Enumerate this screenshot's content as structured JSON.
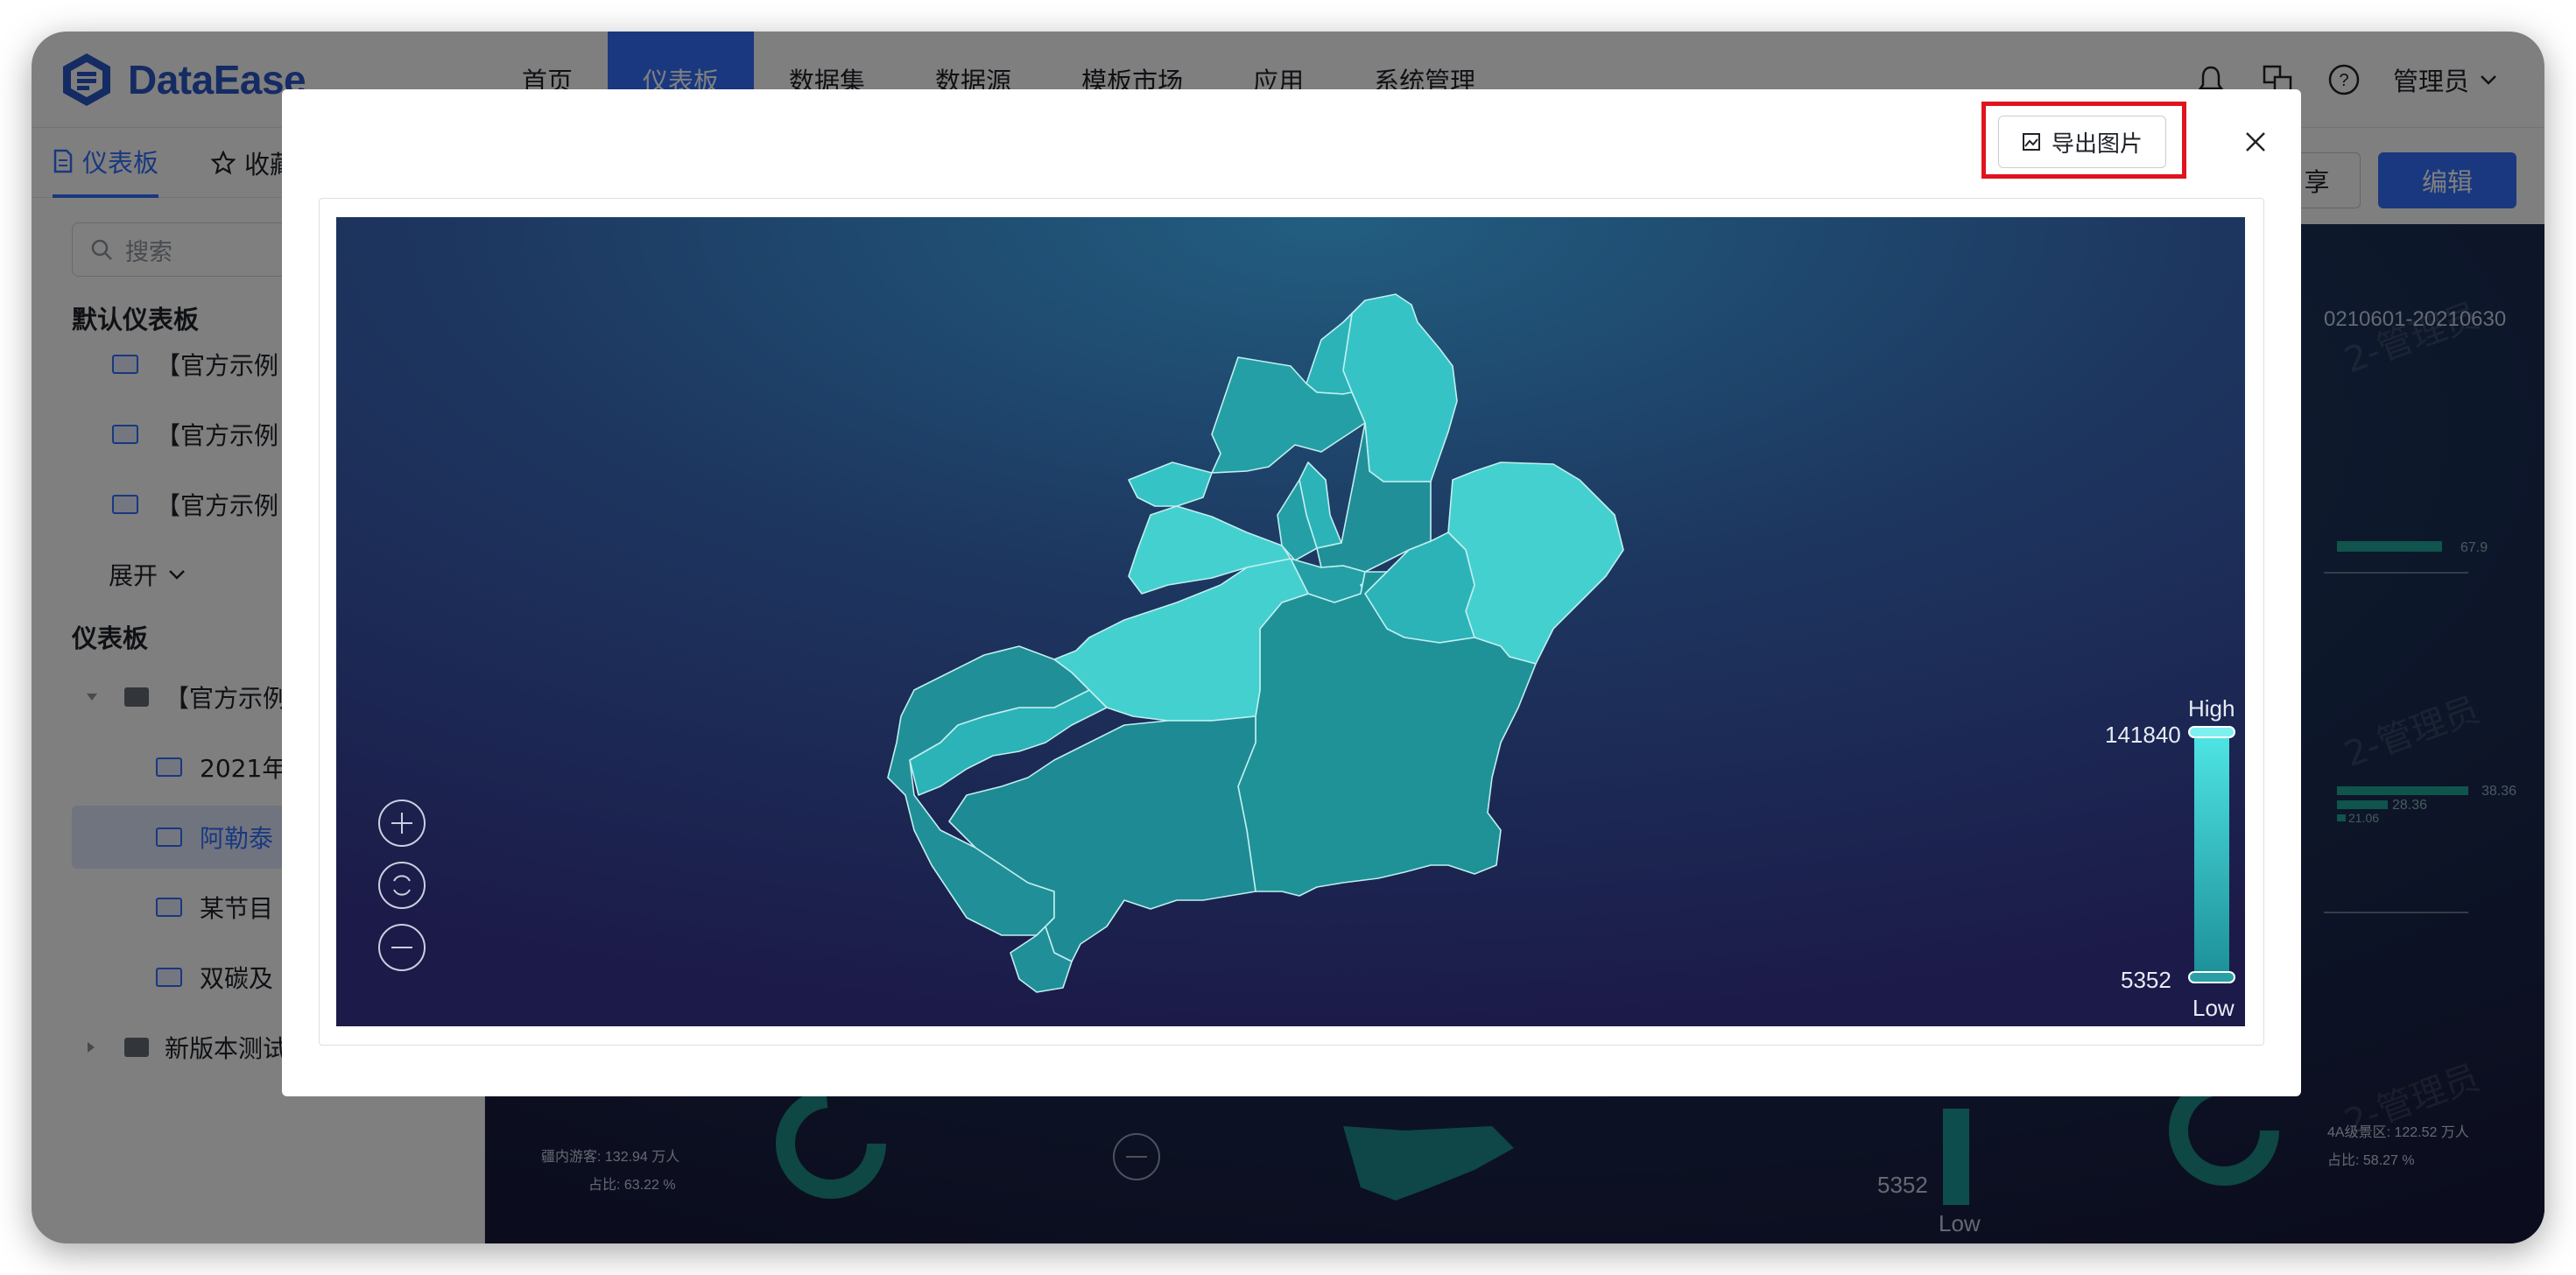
{
  "app": {
    "brand": "DataEase",
    "nav": [
      "首页",
      "仪表板",
      "数据集",
      "数据源",
      "模板市场",
      "应用",
      "系统管理"
    ],
    "active_nav_index": 1,
    "user": "管理员",
    "accent_color": "#3370ff"
  },
  "sidebar": {
    "tabs": [
      "仪表板",
      "收藏"
    ],
    "search_placeholder": "搜索",
    "default_section": "默认仪表板",
    "default_items": [
      "【官方示例",
      "【官方示例",
      "【官方示例"
    ],
    "expand_label": "展开",
    "dash_section": "仪表板",
    "folder1": "【官方示例",
    "folder1_items": [
      "2021年",
      "阿勒泰",
      "某节目",
      "双碳及"
    ],
    "selected_index": 1,
    "folder2": "新版本测试"
  },
  "dashboard": {
    "share_label": "享",
    "edit_label": "编辑",
    "watermark": "2-管理员",
    "date_range": "0210601-20210630",
    "bar_values": [
      "67.9",
      "38.36",
      "28.36",
      "21.06"
    ],
    "left_ring": {
      "label": "疆内游客: 132.94 万人",
      "ratio": "占比: 63.22 %"
    },
    "right_ring": {
      "label": "4A级景区: 122.52 万人",
      "ratio": "占比: 58.27 %"
    },
    "legend_low_value": "5352",
    "legend_low_label": "Low"
  },
  "modal": {
    "export_label": "导出图片",
    "map": {
      "legend_high_label": "High",
      "legend_low_label": "Low",
      "legend_max": "141840",
      "legend_min": "5352",
      "high_color": "#4fd8d8",
      "low_color": "#1e8a96"
    }
  }
}
